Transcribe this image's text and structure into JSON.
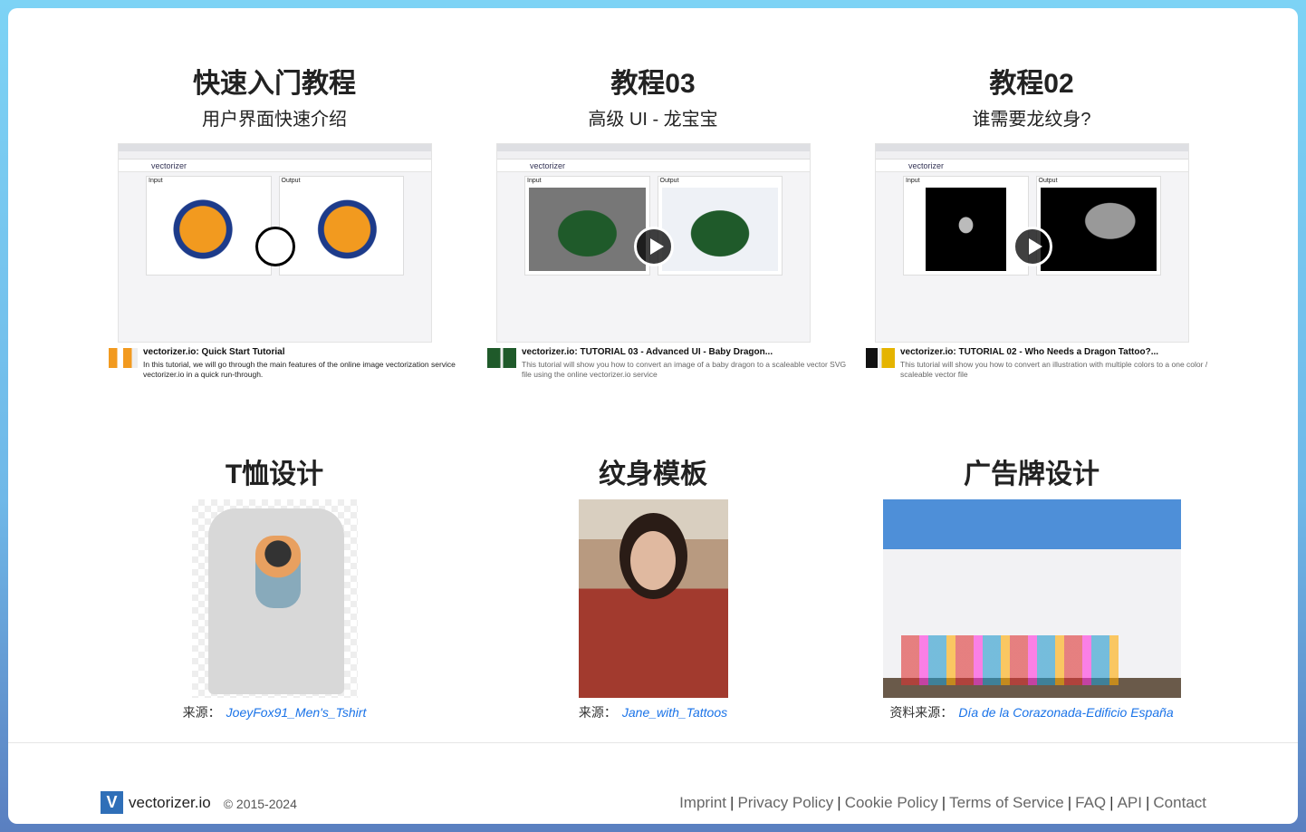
{
  "tutorials": [
    {
      "title": "快速入门教程",
      "subtitle": "用户界面快速介绍",
      "video_title": "vectorizer.io: Quick Start Tutorial",
      "video_desc": "In this tutorial, we will go through the main features of the online image vectorization service vectorizer.io in a quick run-through.",
      "input_label": "Input",
      "output_label": "Output"
    },
    {
      "title": "教程03",
      "subtitle": "高级 UI - 龙宝宝",
      "video_title": "vectorizer.io: TUTORIAL 03 - Advanced UI - Baby Dragon...",
      "video_desc": "This tutorial will show you how to convert an image of a baby dragon to a scaleable vector SVG file using the online vectorizer.io service",
      "input_label": "Input",
      "output_label": "Output"
    },
    {
      "title": "教程02",
      "subtitle": "谁需要龙纹身?",
      "video_title": "vectorizer.io: TUTORIAL 02 - Who Needs a Dragon Tattoo?...",
      "video_desc": "This tutorial will show you how to convert an illustration with multiple colors to a one color / scaleable vector file",
      "input_label": "Input",
      "output_label": "Output"
    }
  ],
  "video_nav_brand": "vectorizer",
  "examples": [
    {
      "title": "T恤设计",
      "source_label": "来源：",
      "source_link": "JoeyFox91_Men's_Tshirt"
    },
    {
      "title": "纹身模板",
      "source_label": "来源：",
      "source_link": "Jane_with_Tattoos"
    },
    {
      "title": "广告牌设计",
      "source_label": "资料来源：",
      "source_link": "Día de la Corazonada-Edificio España"
    }
  ],
  "footer": {
    "brand": "vectorizer.io",
    "copyright": "© 2015-2024",
    "links": [
      "Imprint",
      "Privacy Policy",
      "Cookie Policy",
      "Terms of Service",
      "FAQ",
      "API",
      "Contact"
    ]
  },
  "colors": {
    "link": "#1a73e8",
    "logo": "#2f6fb8"
  }
}
